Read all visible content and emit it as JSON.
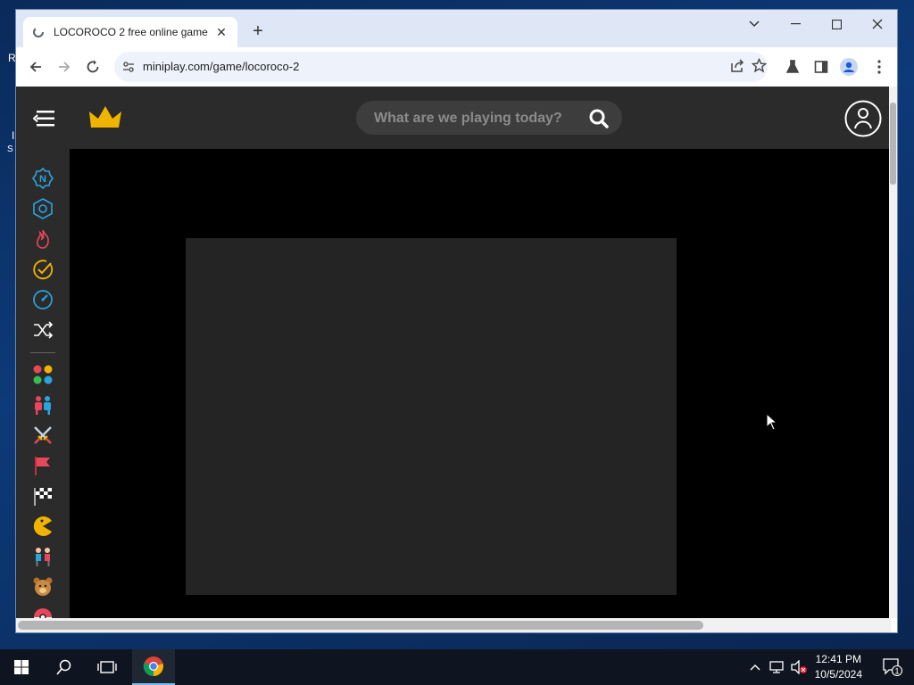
{
  "desktop": {
    "frag_1": "R",
    "frag_2": "I",
    "frag_3": "S"
  },
  "browser": {
    "tab_title": "LOCOROCO 2 free online game",
    "url": "miniplay.com/game/locoroco-2"
  },
  "site": {
    "search_placeholder": "What are we playing today?",
    "sidebar_icons": [
      "new-icon",
      "hexagon-icon",
      "fire-icon",
      "check-icon",
      "speedometer-icon",
      "shuffle-icon",
      "categories-icon",
      "two-player-icon",
      "swords-icon",
      "flag-icon",
      "racing-flag-icon",
      "pacman-icon",
      "kids-icon",
      "bear-icon",
      "pokeball-icon"
    ],
    "colors": {
      "header_bg": "#2b2b2b",
      "crown": "#f0b400",
      "accent_blue": "#2aa4e0"
    }
  },
  "taskbar": {
    "time": "12:41 PM",
    "date": "10/5/2024",
    "notification_count": "1"
  }
}
